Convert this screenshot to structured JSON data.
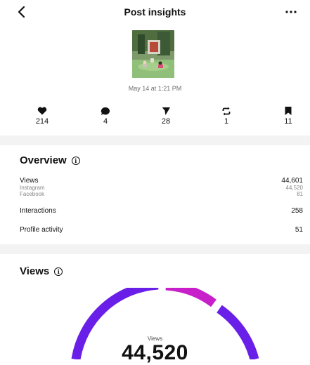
{
  "header": {
    "title": "Post insights"
  },
  "post": {
    "date": "May 14 at 1:21 PM"
  },
  "stats": {
    "likes": "214",
    "comments": "4",
    "shares": "28",
    "reposts": "1",
    "saves": "11"
  },
  "overview": {
    "title": "Overview",
    "views_label": "Views",
    "views_value": "44,601",
    "instagram_label": "Instagram",
    "instagram_value": "44,520",
    "facebook_label": "Facebook",
    "facebook_value": "81",
    "interactions_label": "Interactions",
    "interactions_value": "258",
    "profile_activity_label": "Profile activity",
    "profile_activity_value": "51"
  },
  "views_section": {
    "title": "Views",
    "donut_label": "Views",
    "donut_value": "44,520"
  },
  "colors": {
    "ring_primary": "#6a1fe8",
    "ring_accent": "#c71fc9",
    "divider": "#f3f3f3"
  }
}
